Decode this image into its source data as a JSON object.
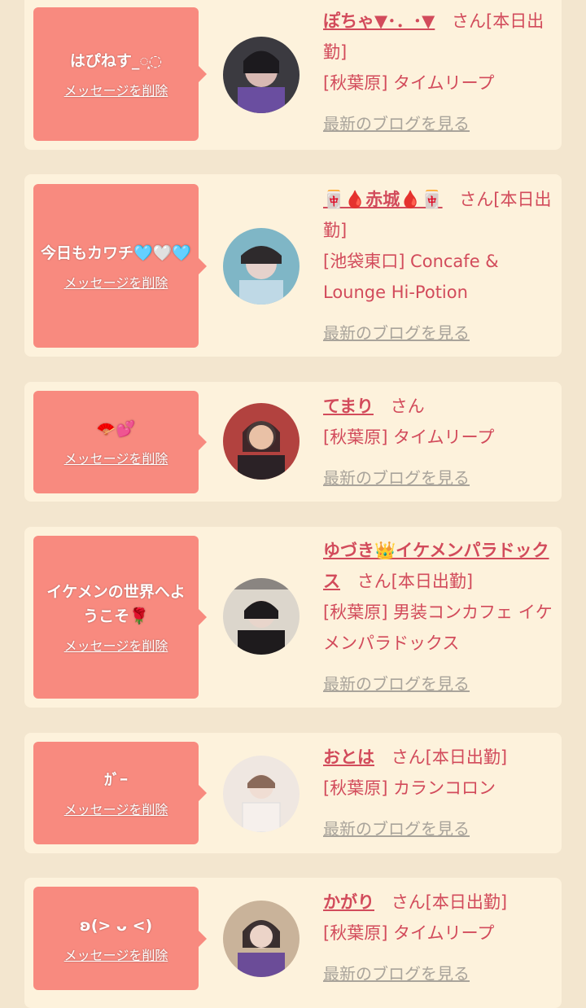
{
  "cards": [
    {
      "message": "はぴねす_◌͙◌",
      "delete_label": "メッセージを削除",
      "name": "ぽちゃ▼･．･▼",
      "suffix": "さん[本日出勤]",
      "shop": "[秋葉原] タイムリープ",
      "blog_label": "最新のブログを見る",
      "avatar_colors": [
        "#3b3a40",
        "#d8b9b3",
        "#6a4ea0"
      ]
    },
    {
      "message": "今日もカワチ🩵🤍🩵",
      "delete_label": "メッセージを削除",
      "name": "🀄🩸赤城🩸🀄",
      "suffix": "さん[本日出勤]",
      "shop": "[池袋東口] Concafe & Lounge Hi-Potion",
      "blog_label": "最新のブログを見る",
      "avatar_colors": [
        "#2e2a2c",
        "#bfd9e6",
        "#7fb6c6"
      ]
    },
    {
      "message": "🪭💕",
      "delete_label": "メッセージを削除",
      "name": "てまり",
      "suffix": "さん",
      "shop": "[秋葉原] タイムリープ",
      "blog_label": "最新のブログを見る",
      "avatar_colors": [
        "#b2423f",
        "#e9c1a6",
        "#2b2226"
      ]
    },
    {
      "message": "イケメンの世界へようこそ🌹",
      "delete_label": "メッセージを削除",
      "name": "ゆづき👑イケメンパラドックス",
      "suffix": "さん[本日出勤]",
      "shop": "[秋葉原] 男装コンカフェ イケメンパラドックス",
      "blog_label": "最新のブログを見る",
      "avatar_colors": [
        "#dcd6cc",
        "#1e1b1d",
        "#8a8581"
      ]
    },
    {
      "message": "ｶﾞｰ",
      "delete_label": "メッセージを削除",
      "name": "おとは",
      "suffix": "さん[本日出勤]",
      "shop": "[秋葉原] カランコロン",
      "blog_label": "最新のブログを見る",
      "avatar_colors": [
        "#efe7e1",
        "#8a6a5a",
        "#f6f0ec"
      ]
    },
    {
      "message": "ʚ(> ᴗ <)",
      "delete_label": "メッセージを削除",
      "name": "かがり",
      "suffix": "さん[本日出勤]",
      "shop": "[秋葉原] タイムリープ",
      "blog_label": "最新のブログを見る",
      "avatar_colors": [
        "#c9b39a",
        "#2a2022",
        "#6b4c98"
      ]
    }
  ]
}
